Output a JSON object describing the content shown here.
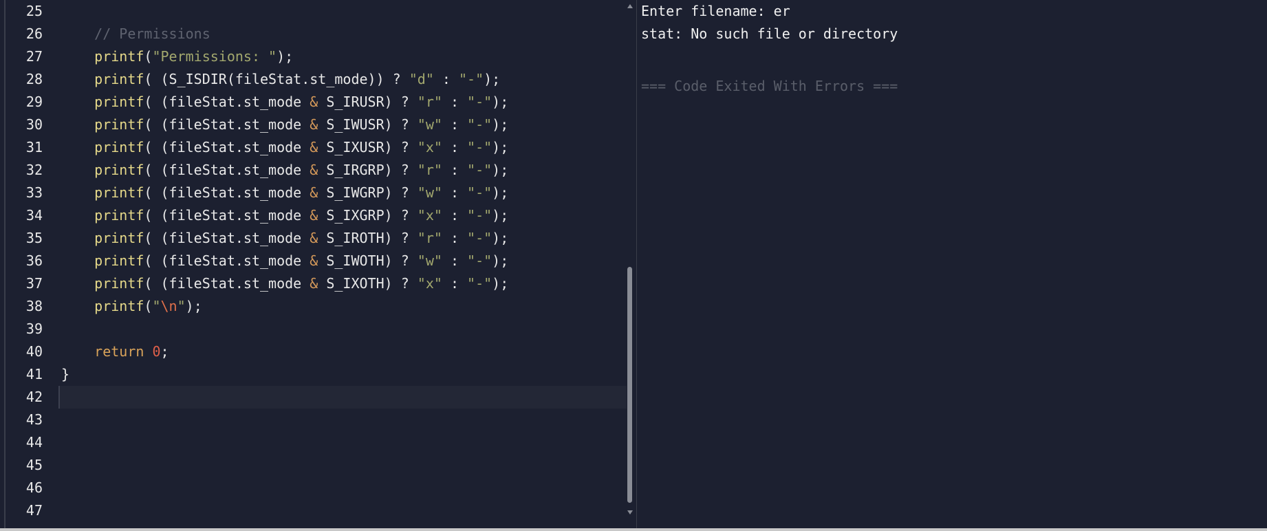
{
  "editor": {
    "active_line": 42,
    "scroll_position_percent": 100,
    "lines": [
      {
        "n": "25",
        "tokens": []
      },
      {
        "n": "26",
        "tokens": [
          {
            "c": "",
            "v": "    "
          },
          {
            "c": "cm",
            "v": "// Permissions"
          }
        ]
      },
      {
        "n": "27",
        "tokens": [
          {
            "c": "",
            "v": "    "
          },
          {
            "c": "fn",
            "v": "printf"
          },
          {
            "c": "",
            "v": "("
          },
          {
            "c": "str",
            "v": "\"Permissions: \""
          },
          {
            "c": "",
            "v": ");"
          }
        ]
      },
      {
        "n": "28",
        "tokens": [
          {
            "c": "",
            "v": "    "
          },
          {
            "c": "fn",
            "v": "printf"
          },
          {
            "c": "",
            "v": "( (S_ISDIR(fileStat.st_mode)) ? "
          },
          {
            "c": "str",
            "v": "\"d\""
          },
          {
            "c": "",
            "v": " : "
          },
          {
            "c": "str",
            "v": "\"-\""
          },
          {
            "c": "",
            "v": ");"
          }
        ]
      },
      {
        "n": "29",
        "tokens": [
          {
            "c": "",
            "v": "    "
          },
          {
            "c": "fn",
            "v": "printf"
          },
          {
            "c": "",
            "v": "( (fileStat.st_mode "
          },
          {
            "c": "op",
            "v": "&"
          },
          {
            "c": "",
            "v": " S_IRUSR) ? "
          },
          {
            "c": "str",
            "v": "\"r\""
          },
          {
            "c": "",
            "v": " : "
          },
          {
            "c": "str",
            "v": "\"-\""
          },
          {
            "c": "",
            "v": ");"
          }
        ]
      },
      {
        "n": "30",
        "tokens": [
          {
            "c": "",
            "v": "    "
          },
          {
            "c": "fn",
            "v": "printf"
          },
          {
            "c": "",
            "v": "( (fileStat.st_mode "
          },
          {
            "c": "op",
            "v": "&"
          },
          {
            "c": "",
            "v": " S_IWUSR) ? "
          },
          {
            "c": "str",
            "v": "\"w\""
          },
          {
            "c": "",
            "v": " : "
          },
          {
            "c": "str",
            "v": "\"-\""
          },
          {
            "c": "",
            "v": ");"
          }
        ]
      },
      {
        "n": "31",
        "tokens": [
          {
            "c": "",
            "v": "    "
          },
          {
            "c": "fn",
            "v": "printf"
          },
          {
            "c": "",
            "v": "( (fileStat.st_mode "
          },
          {
            "c": "op",
            "v": "&"
          },
          {
            "c": "",
            "v": " S_IXUSR) ? "
          },
          {
            "c": "str",
            "v": "\"x\""
          },
          {
            "c": "",
            "v": " : "
          },
          {
            "c": "str",
            "v": "\"-\""
          },
          {
            "c": "",
            "v": ");"
          }
        ]
      },
      {
        "n": "32",
        "tokens": [
          {
            "c": "",
            "v": "    "
          },
          {
            "c": "fn",
            "v": "printf"
          },
          {
            "c": "",
            "v": "( (fileStat.st_mode "
          },
          {
            "c": "op",
            "v": "&"
          },
          {
            "c": "",
            "v": " S_IRGRP) ? "
          },
          {
            "c": "str",
            "v": "\"r\""
          },
          {
            "c": "",
            "v": " : "
          },
          {
            "c": "str",
            "v": "\"-\""
          },
          {
            "c": "",
            "v": ");"
          }
        ]
      },
      {
        "n": "33",
        "tokens": [
          {
            "c": "",
            "v": "    "
          },
          {
            "c": "fn",
            "v": "printf"
          },
          {
            "c": "",
            "v": "( (fileStat.st_mode "
          },
          {
            "c": "op",
            "v": "&"
          },
          {
            "c": "",
            "v": " S_IWGRP) ? "
          },
          {
            "c": "str",
            "v": "\"w\""
          },
          {
            "c": "",
            "v": " : "
          },
          {
            "c": "str",
            "v": "\"-\""
          },
          {
            "c": "",
            "v": ");"
          }
        ]
      },
      {
        "n": "34",
        "tokens": [
          {
            "c": "",
            "v": "    "
          },
          {
            "c": "fn",
            "v": "printf"
          },
          {
            "c": "",
            "v": "( (fileStat.st_mode "
          },
          {
            "c": "op",
            "v": "&"
          },
          {
            "c": "",
            "v": " S_IXGRP) ? "
          },
          {
            "c": "str",
            "v": "\"x\""
          },
          {
            "c": "",
            "v": " : "
          },
          {
            "c": "str",
            "v": "\"-\""
          },
          {
            "c": "",
            "v": ");"
          }
        ]
      },
      {
        "n": "35",
        "tokens": [
          {
            "c": "",
            "v": "    "
          },
          {
            "c": "fn",
            "v": "printf"
          },
          {
            "c": "",
            "v": "( (fileStat.st_mode "
          },
          {
            "c": "op",
            "v": "&"
          },
          {
            "c": "",
            "v": " S_IROTH) ? "
          },
          {
            "c": "str",
            "v": "\"r\""
          },
          {
            "c": "",
            "v": " : "
          },
          {
            "c": "str",
            "v": "\"-\""
          },
          {
            "c": "",
            "v": ");"
          }
        ]
      },
      {
        "n": "36",
        "tokens": [
          {
            "c": "",
            "v": "    "
          },
          {
            "c": "fn",
            "v": "printf"
          },
          {
            "c": "",
            "v": "( (fileStat.st_mode "
          },
          {
            "c": "op",
            "v": "&"
          },
          {
            "c": "",
            "v": " S_IWOTH) ? "
          },
          {
            "c": "str",
            "v": "\"w\""
          },
          {
            "c": "",
            "v": " : "
          },
          {
            "c": "str",
            "v": "\"-\""
          },
          {
            "c": "",
            "v": ");"
          }
        ]
      },
      {
        "n": "37",
        "tokens": [
          {
            "c": "",
            "v": "    "
          },
          {
            "c": "fn",
            "v": "printf"
          },
          {
            "c": "",
            "v": "( (fileStat.st_mode "
          },
          {
            "c": "op",
            "v": "&"
          },
          {
            "c": "",
            "v": " S_IXOTH) ? "
          },
          {
            "c": "str",
            "v": "\"x\""
          },
          {
            "c": "",
            "v": " : "
          },
          {
            "c": "str",
            "v": "\"-\""
          },
          {
            "c": "",
            "v": ");"
          }
        ]
      },
      {
        "n": "38",
        "tokens": [
          {
            "c": "",
            "v": "    "
          },
          {
            "c": "fn",
            "v": "printf"
          },
          {
            "c": "",
            "v": "("
          },
          {
            "c": "str",
            "v": "\""
          },
          {
            "c": "esc",
            "v": "\\n"
          },
          {
            "c": "str",
            "v": "\""
          },
          {
            "c": "",
            "v": ");"
          }
        ]
      },
      {
        "n": "39",
        "tokens": []
      },
      {
        "n": "40",
        "tokens": [
          {
            "c": "",
            "v": "    "
          },
          {
            "c": "kw",
            "v": "return"
          },
          {
            "c": "",
            "v": " "
          },
          {
            "c": "num",
            "v": "0"
          },
          {
            "c": "",
            "v": ";"
          }
        ]
      },
      {
        "n": "41",
        "tokens": [
          {
            "c": "",
            "v": "}"
          }
        ]
      },
      {
        "n": "42",
        "tokens": []
      },
      {
        "n": "43",
        "tokens": []
      },
      {
        "n": "44",
        "tokens": []
      },
      {
        "n": "45",
        "tokens": []
      },
      {
        "n": "46",
        "tokens": []
      },
      {
        "n": "47",
        "tokens": []
      }
    ]
  },
  "output": {
    "prompt": "Enter filename: er",
    "error": "stat: No such file or directory",
    "exit_status": "=== Code Exited With Errors ==="
  }
}
